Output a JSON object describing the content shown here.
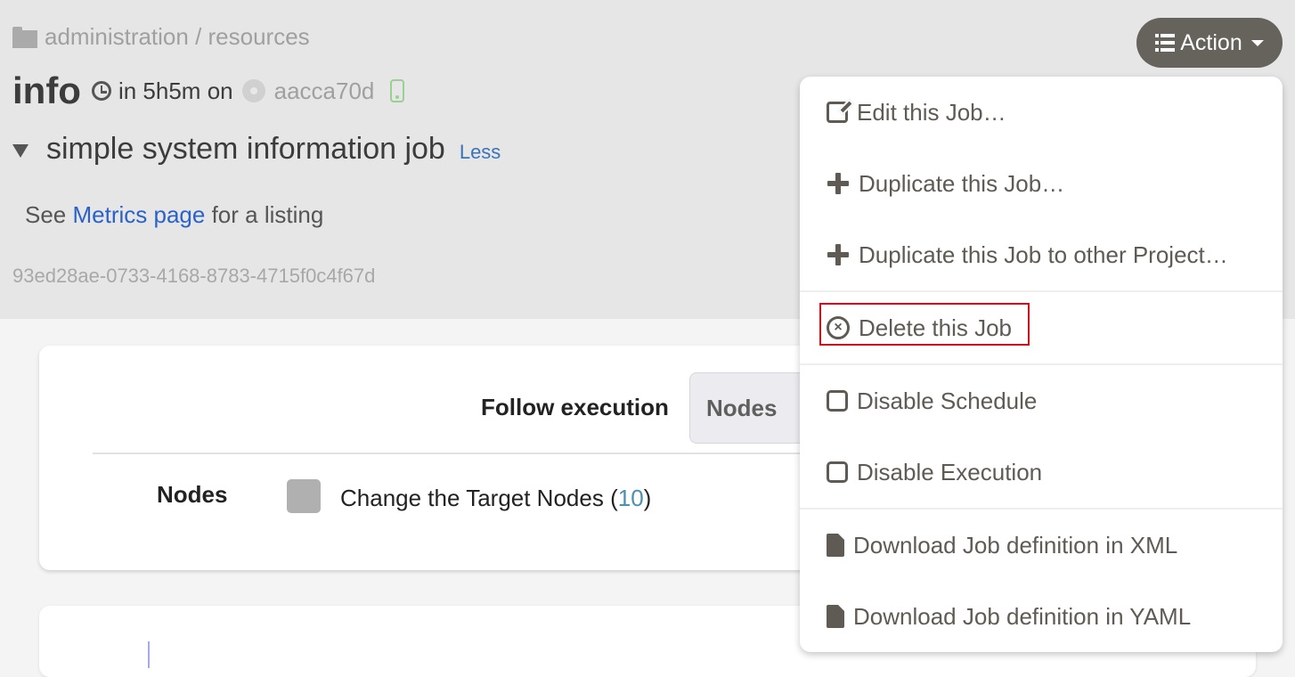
{
  "breadcrumb": {
    "icon": "folder-icon",
    "text": "administration / resources"
  },
  "job": {
    "name": "info",
    "schedule_icon": "clock-icon",
    "schedule_text": "in 5h5m on",
    "node_icon": "node-status-icon",
    "node_name": "aacca70d",
    "device_icon": "mobile-icon",
    "description": "simple system information job",
    "less_label": "Less",
    "see_prefix": "See ",
    "metrics_link": "Metrics page",
    "see_suffix": " for a listing",
    "uuid": "93ed28ae-0733-4168-8783-4715f0c4f67d"
  },
  "action_button": {
    "label": "Action",
    "icon": "list-icon",
    "caret_icon": "caret-down-icon"
  },
  "card": {
    "follow_label": "Follow execution",
    "tab_label": "Nodes",
    "nodes_label": "Nodes",
    "target_prefix": "Change the Target Nodes (",
    "target_count": "10",
    "target_suffix": ")"
  },
  "dropdown": {
    "items": [
      {
        "label": "Edit this Job…",
        "icon": "edit-icon"
      },
      {
        "label": "Duplicate this Job…",
        "icon": "plus-icon"
      },
      {
        "label": "Duplicate this Job to other Project…",
        "icon": "plus-icon"
      },
      {
        "label": "Delete this Job",
        "icon": "times-circle-icon",
        "highlighted": true
      },
      {
        "label": "Disable Schedule",
        "icon": "square-icon"
      },
      {
        "label": "Disable Execution",
        "icon": "square-icon"
      },
      {
        "label": "Download Job definition in XML",
        "icon": "file-icon"
      },
      {
        "label": "Download Job definition in YAML",
        "icon": "file-icon"
      }
    ]
  },
  "colors": {
    "header_bg": "#e6e6e6",
    "action_bg": "#66625c",
    "link": "#2a62c9",
    "highlight": "#d0101a",
    "node_count": "#4a90b0"
  }
}
